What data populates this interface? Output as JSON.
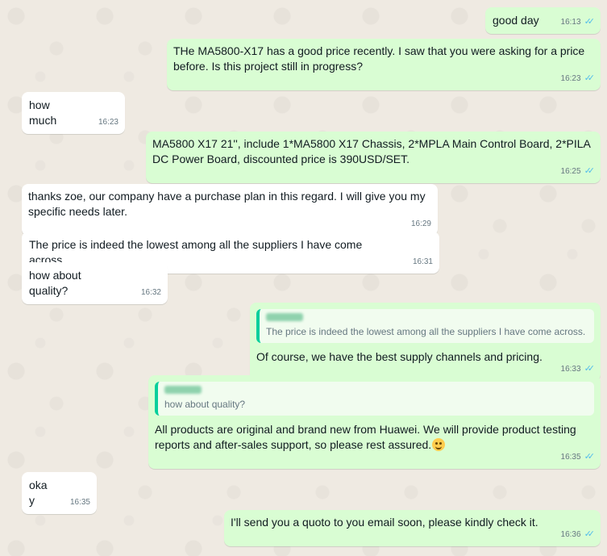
{
  "messages": [
    {
      "id": "m1",
      "direction": "out",
      "text": "good day",
      "time": "16:13",
      "status": "read"
    },
    {
      "id": "m2",
      "direction": "out",
      "text": "THe MA5800-X17 has a good price recently. I saw that you were asking for a price before. Is this project still in progress?",
      "time": "16:23",
      "status": "read"
    },
    {
      "id": "m3",
      "direction": "in",
      "text": "how much",
      "time": "16:23"
    },
    {
      "id": "m4",
      "direction": "out",
      "text": "MA5800 X17 21'', include 1*MA5800 X17 Chassis, 2*MPLA Main Control Board, 2*PILA DC Power Board, discounted price is 390USD/SET.",
      "time": "16:25",
      "status": "read"
    },
    {
      "id": "m5",
      "direction": "in",
      "text": "thanks zoe, our company have a purchase plan in this regard. I will give you my specific needs later.",
      "time": "16:29"
    },
    {
      "id": "m6",
      "direction": "in",
      "text": "The price is indeed the lowest among all the suppliers I have come across.",
      "time": "16:31"
    },
    {
      "id": "m7",
      "direction": "in",
      "text": "how about quality?",
      "time": "16:32"
    },
    {
      "id": "m8",
      "direction": "out",
      "quoted_text": "The price is indeed the lowest among all the suppliers I have come across.",
      "text": "Of course, we have the best supply channels and pricing.",
      "time": "16:33",
      "status": "read"
    },
    {
      "id": "m9",
      "direction": "out",
      "quoted_text": "how about quality?",
      "text": "All products are original and brand new from Huawei. We will provide product testing reports and after-sales support, so please rest assured.",
      "emoji": "slightly-smiling-face",
      "time": "16:35",
      "status": "read"
    },
    {
      "id": "m10",
      "direction": "in",
      "text": "okay",
      "time": "16:35"
    },
    {
      "id": "m11",
      "direction": "out",
      "text": "I'll send you a quoto to you email soon, please kindly check it.",
      "time": "16:36",
      "status": "read"
    }
  ],
  "colors": {
    "background": "#efeae2",
    "incoming_bubble": "#ffffff",
    "outgoing_bubble": "#d9fdd3",
    "read_tick": "#53bdeb",
    "quote_bar": "#06cf9c",
    "meta_text": "#667781"
  }
}
